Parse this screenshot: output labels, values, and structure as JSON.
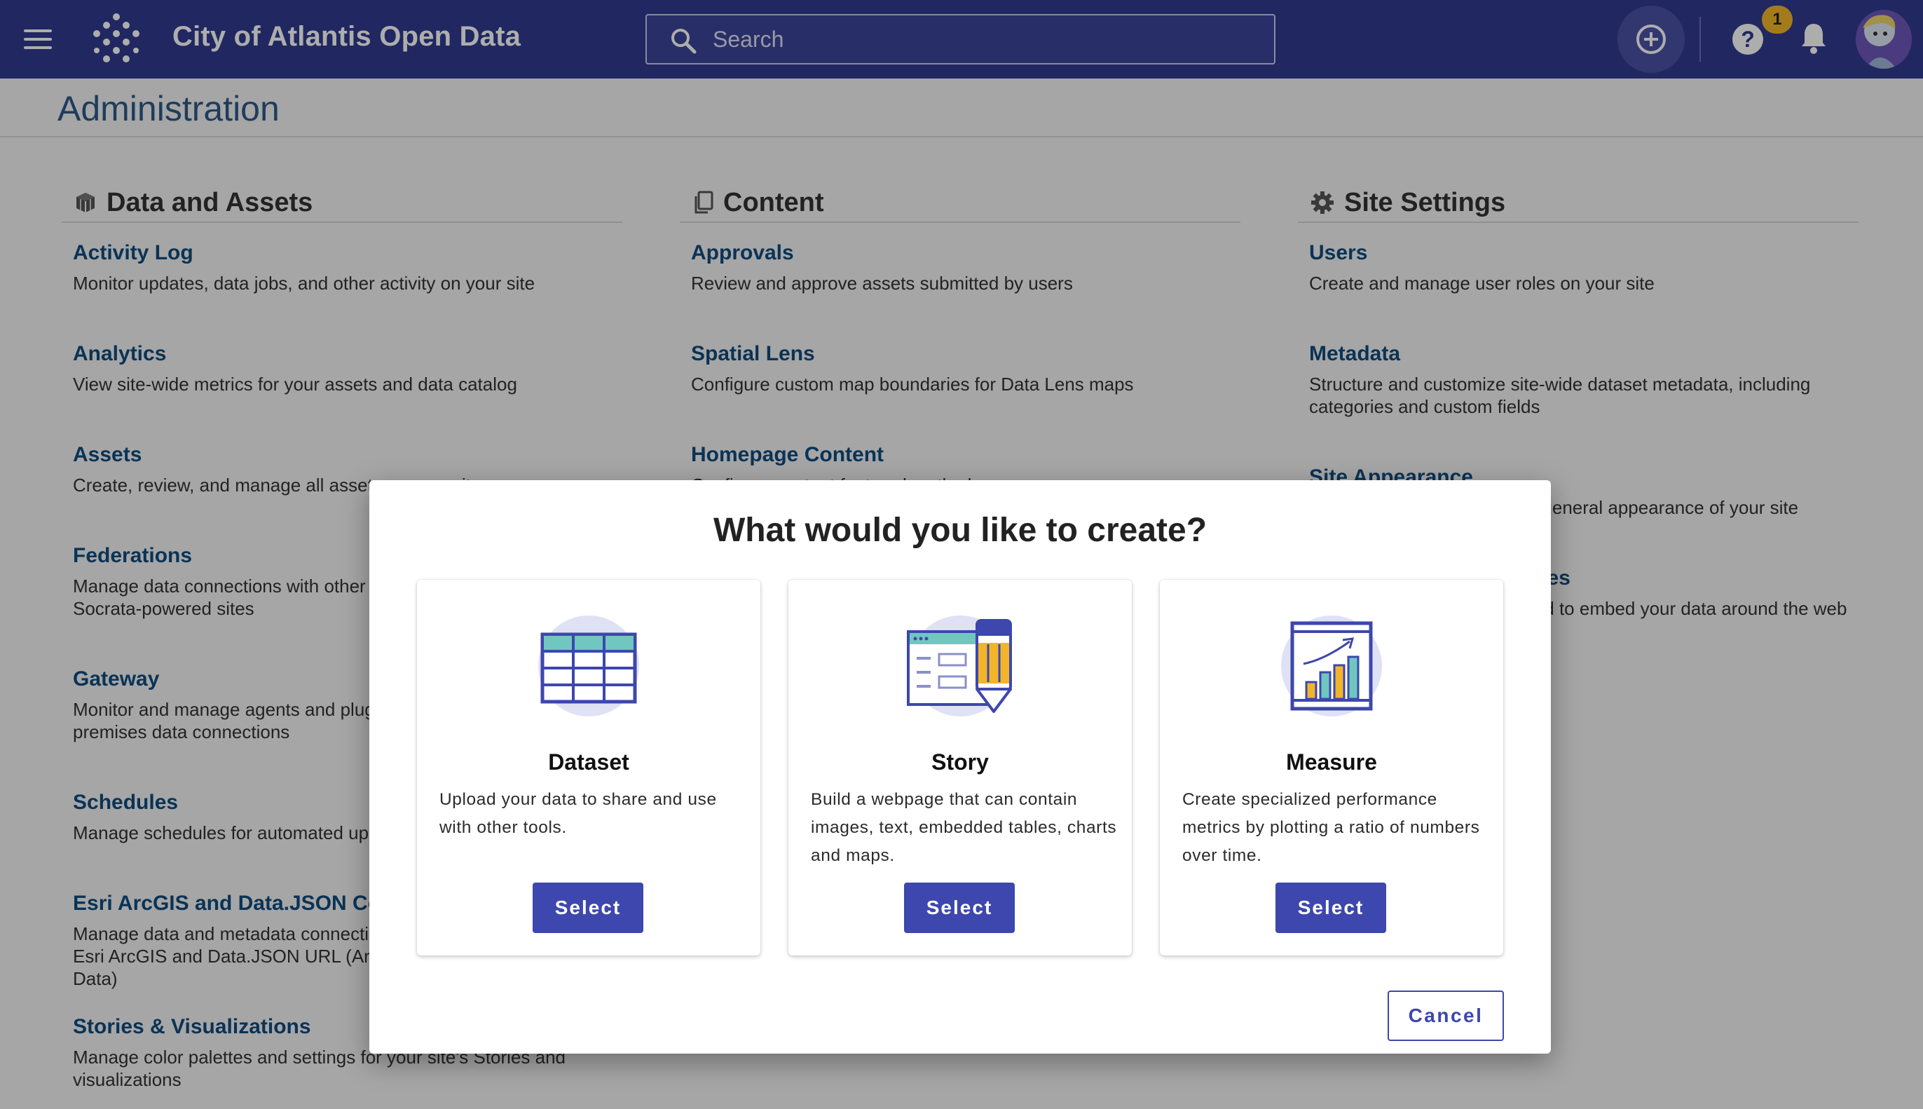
{
  "header": {
    "site_title": "City of Atlantis Open Data",
    "search_placeholder": "Search",
    "notification_count": "1",
    "help_label": "?",
    "icons": [
      "menu-icon",
      "logo-icon",
      "search-icon",
      "add-circle-icon",
      "help-icon",
      "bell-icon",
      "avatar"
    ]
  },
  "page": {
    "title": "Administration",
    "columns": [
      {
        "heading": "Data and Assets",
        "icon": "cubes-icon",
        "items": [
          {
            "title": "Activity Log",
            "desc": "Monitor updates, data jobs, and other activity on your site"
          },
          {
            "title": "Analytics",
            "desc": "View site-wide metrics for your assets and data catalog"
          },
          {
            "title": "Assets",
            "desc": "Create, review, and manage all assets on your site"
          },
          {
            "title": "Federations",
            "desc": "Manage data connections with other Socrata-powered sites"
          },
          {
            "title": "Gateway",
            "desc": "Monitor and manage agents and plugins for on-premises data connections"
          },
          {
            "title": "Schedules",
            "desc": "Manage schedules for automated updates"
          },
          {
            "title": "Esri ArcGIS and Data.JSON Connections",
            "desc": "Manage data and metadata connections from Esri ArcGIS and Data.JSON URL (ArcGIS Open Data)"
          },
          {
            "title": "Stories & Visualizations",
            "desc": "Manage color palettes and settings for your site's Stories and visualizations"
          }
        ]
      },
      {
        "heading": "Content",
        "icon": "copy-icon",
        "items": [
          {
            "title": "Approvals",
            "desc": "Review and approve assets submitted by users"
          },
          {
            "title": "Spatial Lens",
            "desc": "Configure custom map boundaries for Data Lens maps"
          },
          {
            "title": "Homepage Content",
            "desc": "Configure content featured on the homepage"
          }
        ]
      },
      {
        "heading": "Site Settings",
        "icon": "gear-icon",
        "items": [
          {
            "title": "Users",
            "desc": "Create and manage user roles on your site"
          },
          {
            "title": "Metadata",
            "desc": "Structure and customize site-wide dataset metadata, including categories and custom fields"
          },
          {
            "title": "Site Appearance",
            "desc": "Customize the branding and general appearance of your site"
          },
          {
            "title": "Embed (Player) Templates",
            "desc": "Customize the templates used to embed your data around the web"
          }
        ]
      }
    ]
  },
  "modal": {
    "title": "What would you like to create?",
    "cards": [
      {
        "title": "Dataset",
        "desc": "Upload your data to share and use with other tools.",
        "button": "Select",
        "icon": "table-icon"
      },
      {
        "title": "Story",
        "desc": "Build a webpage that can contain images, text, embedded tables, charts and maps.",
        "button": "Select",
        "icon": "story-pencil-icon"
      },
      {
        "title": "Measure",
        "desc": "Create specialized performance metrics by plotting a ratio of numbers over time.",
        "button": "Select",
        "icon": "bar-chart-icon"
      }
    ],
    "cancel": "Cancel"
  },
  "colors": {
    "header_bg": "#323a8f",
    "link": "#0f4c7f",
    "primary_button": "#3d47ad",
    "badge": "#f2b52a"
  }
}
